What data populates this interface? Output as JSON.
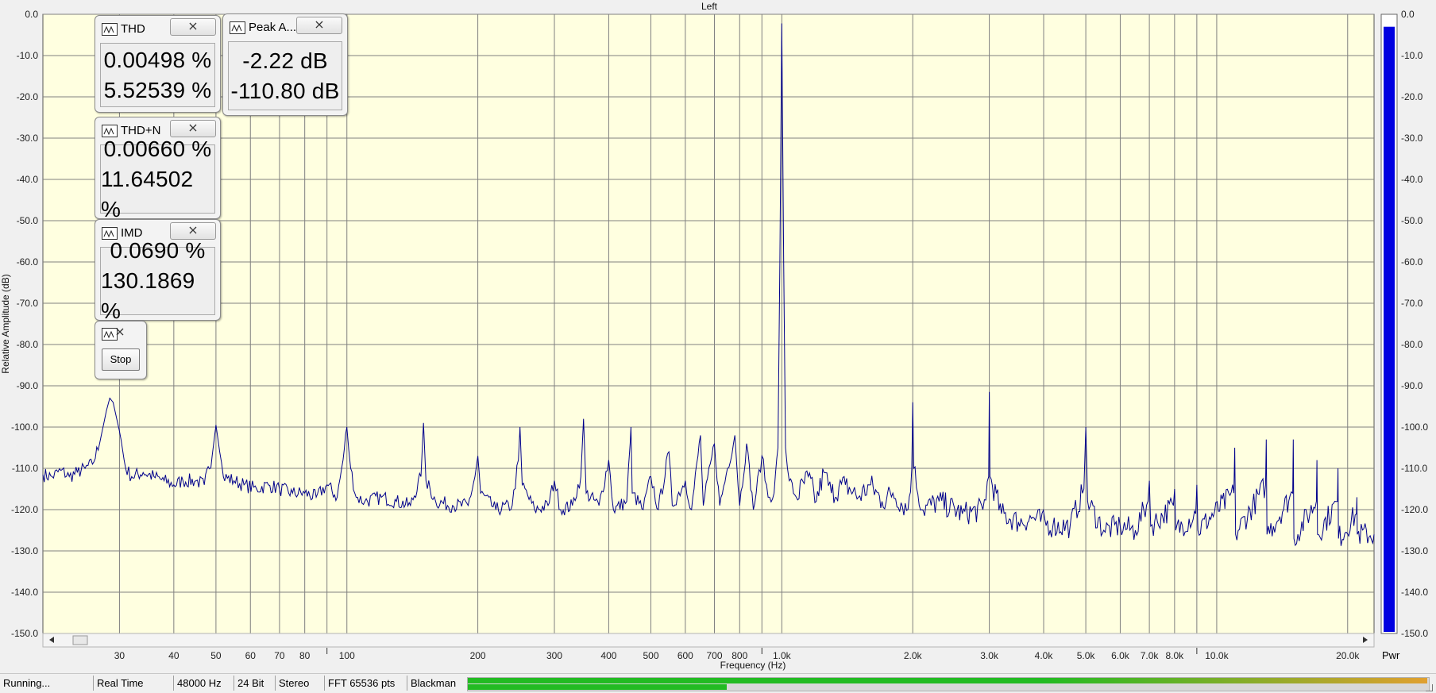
{
  "window": {
    "channel_title": "Left"
  },
  "meters": {
    "thd": {
      "title": "THD",
      "value1": "0.00498 %",
      "value2": "5.52539 %"
    },
    "peak": {
      "title": "Peak A...",
      "value1": "-2.22 dB",
      "value2": "-110.80 dB"
    },
    "thdn": {
      "title": "THD+N",
      "value1": "0.00660 %",
      "value2": "11.64502 %"
    },
    "imd": {
      "title": "IMD",
      "value1": "0.0690 %",
      "value2": "130.1869 %"
    },
    "control": {
      "stop_label": "Stop"
    },
    "close_glyph": "⨯"
  },
  "status_bar": {
    "state": "Running...",
    "mode": "Real Time",
    "sample_rate": "48000 Hz",
    "bit_depth": "24 Bit",
    "channels": "Stereo",
    "fft_size": "FFT 65536 pts",
    "window": "Blackman",
    "level_top": 1.0,
    "level_bottom": 0.27
  },
  "pwr_meter": {
    "label": "Pwr",
    "level": 0.99,
    "color": "#0000e0"
  },
  "colors": {
    "plot_bg": "#ffffe0",
    "trace": "#00008b",
    "grid": "#808080",
    "level_green": "#22bb22",
    "level_orange": "#e0a030"
  },
  "chart_data": {
    "type": "line",
    "title": "Left",
    "xlabel": "Frequency (Hz)",
    "ylabel": "Relative Amplitude (dB)",
    "x_scale": "log",
    "xlim": [
      20,
      23000
    ],
    "ylim": [
      -150,
      0
    ],
    "grid": true,
    "y_ticks": [
      "0.0",
      "-10.0",
      "-20.0",
      "-30.0",
      "-40.0",
      "-50.0",
      "-60.0",
      "-70.0",
      "-80.0",
      "-90.0",
      "-100.0",
      "-110.0",
      "-120.0",
      "-130.0",
      "-140.0",
      "-150.0"
    ],
    "pwr_ticks": [
      "0.0",
      "-10.0",
      "-20.0",
      "-30.0",
      "-40.0",
      "-50.0",
      "-60.0",
      "-70.0",
      "-80.0",
      "-90.0",
      "-100.0",
      "-110.0",
      "-120.0",
      "-130.0",
      "-140.0",
      "-150.0"
    ],
    "x_ticks": [
      {
        "label": "30",
        "f": 30
      },
      {
        "label": "40",
        "f": 40
      },
      {
        "label": "50",
        "f": 50
      },
      {
        "label": "60",
        "f": 60
      },
      {
        "label": "70",
        "f": 70
      },
      {
        "label": "80",
        "f": 80
      },
      {
        "label": "100",
        "f": 100
      },
      {
        "label": "200",
        "f": 200
      },
      {
        "label": "300",
        "f": 300
      },
      {
        "label": "400",
        "f": 400
      },
      {
        "label": "500",
        "f": 500
      },
      {
        "label": "600",
        "f": 600
      },
      {
        "label": "700",
        "f": 700
      },
      {
        "label": "800",
        "f": 800
      },
      {
        "label": "1.0k",
        "f": 1000
      },
      {
        "label": "2.0k",
        "f": 2000
      },
      {
        "label": "3.0k",
        "f": 3000
      },
      {
        "label": "4.0k",
        "f": 4000
      },
      {
        "label": "5.0k",
        "f": 5000
      },
      {
        "label": "6.0k",
        "f": 6000
      },
      {
        "label": "7.0k",
        "f": 7000
      },
      {
        "label": "8.0k",
        "f": 8000
      },
      {
        "label": "10.0k",
        "f": 10000
      },
      {
        "label": "20.0k",
        "f": 20000
      }
    ],
    "x_minor_grid": [
      90,
      900,
      9000
    ],
    "series": [
      {
        "values": [
          [
            20,
            -111.5
          ],
          [
            21,
            -112
          ],
          [
            22,
            -110.5
          ],
          [
            23,
            -112
          ],
          [
            24,
            -111
          ],
          [
            25,
            -110
          ],
          [
            26,
            -109
          ],
          [
            27,
            -104
          ],
          [
            28,
            -96
          ],
          [
            28.5,
            -93
          ],
          [
            29,
            -94
          ],
          [
            30,
            -101
          ],
          [
            31,
            -110
          ],
          [
            32,
            -112
          ],
          [
            34,
            -111
          ],
          [
            36,
            -112
          ],
          [
            38,
            -113
          ],
          [
            40,
            -114
          ],
          [
            42,
            -113
          ],
          [
            45,
            -113
          ],
          [
            47,
            -114
          ],
          [
            49,
            -107
          ],
          [
            50,
            -99.5
          ],
          [
            51,
            -106
          ],
          [
            52,
            -112
          ],
          [
            55,
            -113
          ],
          [
            58,
            -114
          ],
          [
            62,
            -115
          ],
          [
            66,
            -114
          ],
          [
            70,
            -115
          ],
          [
            75,
            -116
          ],
          [
            80,
            -116
          ],
          [
            85,
            -117
          ],
          [
            90,
            -114
          ],
          [
            95,
            -117
          ],
          [
            98,
            -108
          ],
          [
            100,
            -100
          ],
          [
            102,
            -110
          ],
          [
            105,
            -117
          ],
          [
            110,
            -118
          ],
          [
            120,
            -117
          ],
          [
            130,
            -118
          ],
          [
            140,
            -119
          ],
          [
            148,
            -112
          ],
          [
            150,
            -99
          ],
          [
            152,
            -113
          ],
          [
            160,
            -118
          ],
          [
            175,
            -119
          ],
          [
            190,
            -119
          ],
          [
            197,
            -112
          ],
          [
            200,
            -107
          ],
          [
            203,
            -116
          ],
          [
            220,
            -120
          ],
          [
            240,
            -119
          ],
          [
            248,
            -108
          ],
          [
            250,
            -100
          ],
          [
            253,
            -114
          ],
          [
            270,
            -120
          ],
          [
            290,
            -119
          ],
          [
            300,
            -113
          ],
          [
            310,
            -120
          ],
          [
            330,
            -119
          ],
          [
            345,
            -112
          ],
          [
            350,
            -98
          ],
          [
            355,
            -116
          ],
          [
            380,
            -119
          ],
          [
            400,
            -108
          ],
          [
            410,
            -120
          ],
          [
            440,
            -118
          ],
          [
            448,
            -104
          ],
          [
            450,
            -100
          ],
          [
            453,
            -116
          ],
          [
            480,
            -120
          ],
          [
            500,
            -112
          ],
          [
            520,
            -120
          ],
          [
            550,
            -106
          ],
          [
            560,
            -119
          ],
          [
            600,
            -113
          ],
          [
            620,
            -120
          ],
          [
            650,
            -102
          ],
          [
            660,
            -119
          ],
          [
            700,
            -104
          ],
          [
            720,
            -119
          ],
          [
            750,
            -110
          ],
          [
            780,
            -102
          ],
          [
            800,
            -119
          ],
          [
            830,
            -104
          ],
          [
            860,
            -120
          ],
          [
            900,
            -107
          ],
          [
            930,
            -117
          ],
          [
            960,
            -116
          ],
          [
            980,
            -105
          ],
          [
            990,
            -60
          ],
          [
            1000,
            -2.22
          ],
          [
            1010,
            -60
          ],
          [
            1020,
            -105
          ],
          [
            1040,
            -113
          ],
          [
            1080,
            -117
          ],
          [
            1150,
            -112
          ],
          [
            1200,
            -118
          ],
          [
            1250,
            -111
          ],
          [
            1300,
            -116
          ],
          [
            1400,
            -114
          ],
          [
            1500,
            -117
          ],
          [
            1600,
            -114
          ],
          [
            1700,
            -118
          ],
          [
            1800,
            -116
          ],
          [
            1950,
            -120
          ],
          [
            1990,
            -110
          ],
          [
            2000,
            -94
          ],
          [
            2010,
            -110
          ],
          [
            2100,
            -120
          ],
          [
            2300,
            -118
          ],
          [
            2600,
            -121
          ],
          [
            2900,
            -120
          ],
          [
            2990,
            -112
          ],
          [
            3000,
            -91.5
          ],
          [
            3010,
            -112
          ],
          [
            3200,
            -121
          ],
          [
            3500,
            -123
          ],
          [
            3800,
            -122
          ],
          [
            4200,
            -124
          ],
          [
            4600,
            -124
          ],
          [
            4950,
            -115
          ],
          [
            5000,
            -100
          ],
          [
            5050,
            -118
          ],
          [
            5500,
            -125
          ],
          [
            6000,
            -124
          ],
          [
            6500,
            -125
          ],
          [
            6950,
            -118
          ],
          [
            7000,
            -113
          ],
          [
            7050,
            -124
          ],
          [
            7950,
            -119
          ],
          [
            8000,
            -115
          ],
          [
            8050,
            -125
          ],
          [
            8950,
            -121
          ],
          [
            9000,
            -114
          ],
          [
            9050,
            -125
          ],
          [
            10950,
            -116
          ],
          [
            11000,
            -105
          ],
          [
            11050,
            -126
          ],
          [
            12950,
            -114
          ],
          [
            13000,
            -103
          ],
          [
            13050,
            -126
          ],
          [
            14950,
            -116
          ],
          [
            15000,
            -103
          ],
          [
            15050,
            -127
          ],
          [
            16950,
            -118
          ],
          [
            17000,
            -108
          ],
          [
            17050,
            -126
          ],
          [
            18950,
            -118
          ],
          [
            19000,
            -110
          ],
          [
            19050,
            -127
          ],
          [
            20950,
            -121
          ],
          [
            21000,
            -117
          ],
          [
            21050,
            -126
          ],
          [
            23000,
            -126
          ]
        ]
      }
    ]
  }
}
